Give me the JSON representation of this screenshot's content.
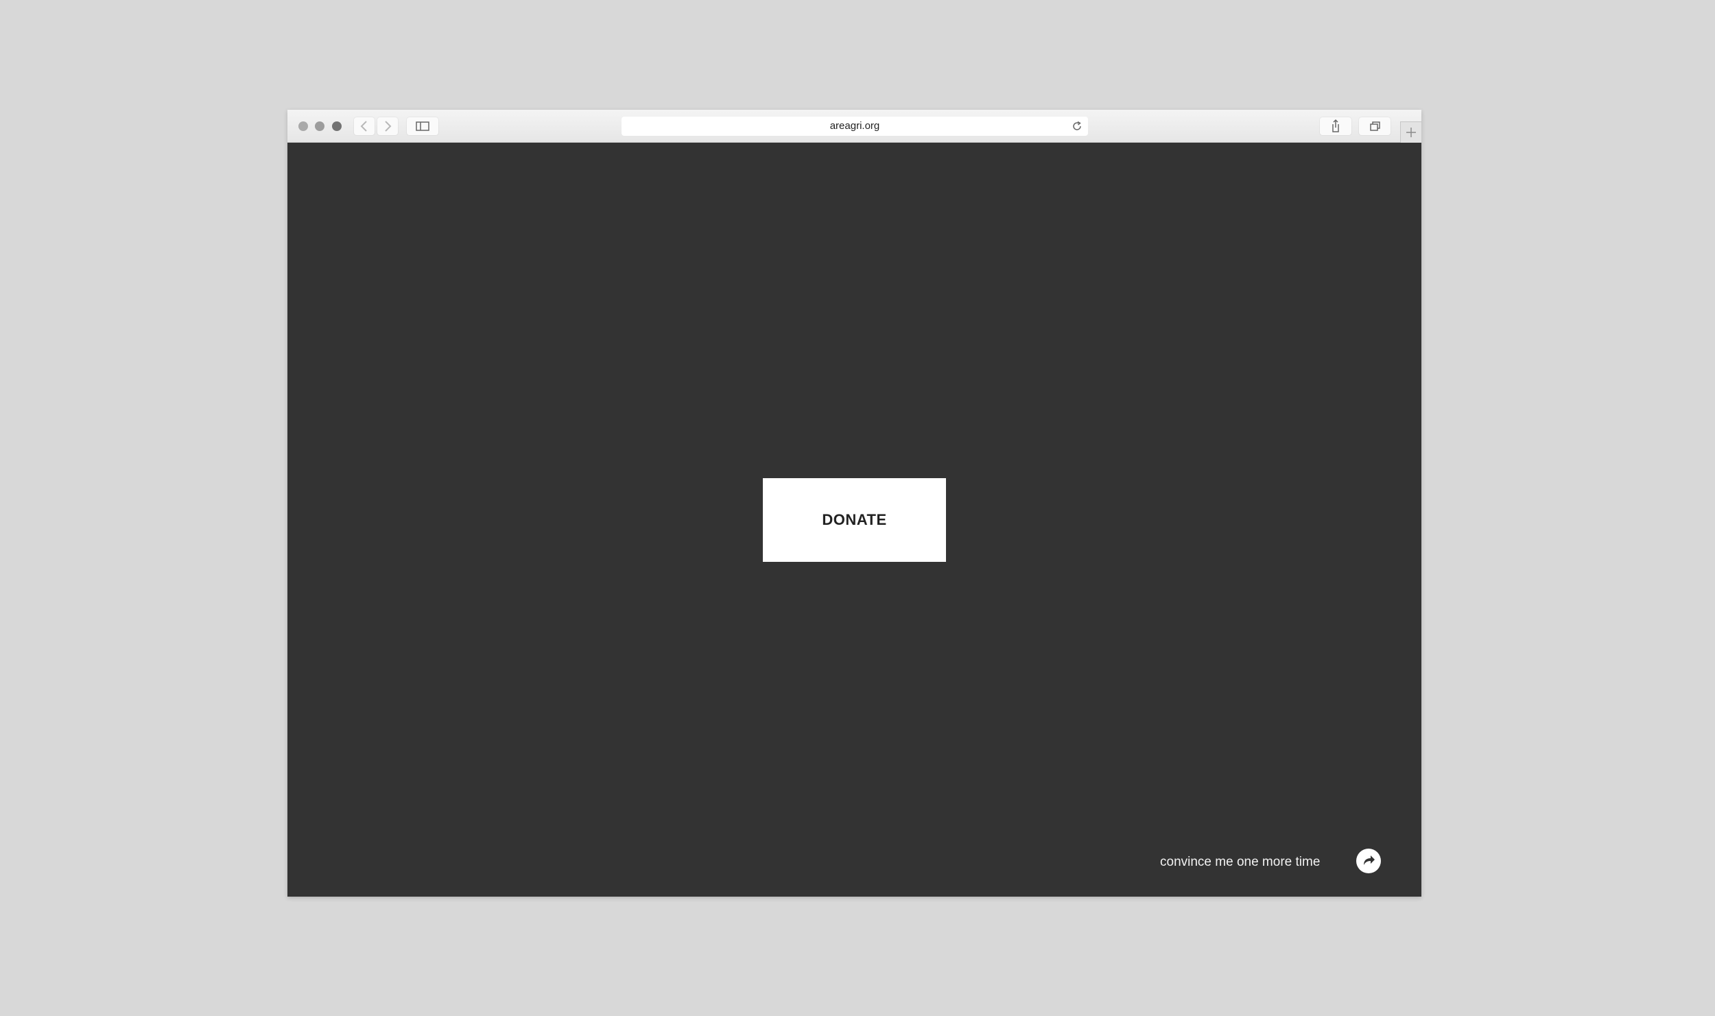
{
  "browser": {
    "url": "areagri.org",
    "icons": {
      "back": "chevron-left-icon",
      "forward": "chevron-right-icon",
      "sidebar": "sidebar-icon",
      "reload": "reload-icon",
      "share": "share-icon",
      "tabs": "tabs-overview-icon",
      "new_tab": "plus-icon"
    }
  },
  "page": {
    "background_color": "#333333",
    "donate_label": "DONATE",
    "convince_text": "convince me one more time",
    "share_icon": "forward-arrow-icon"
  }
}
